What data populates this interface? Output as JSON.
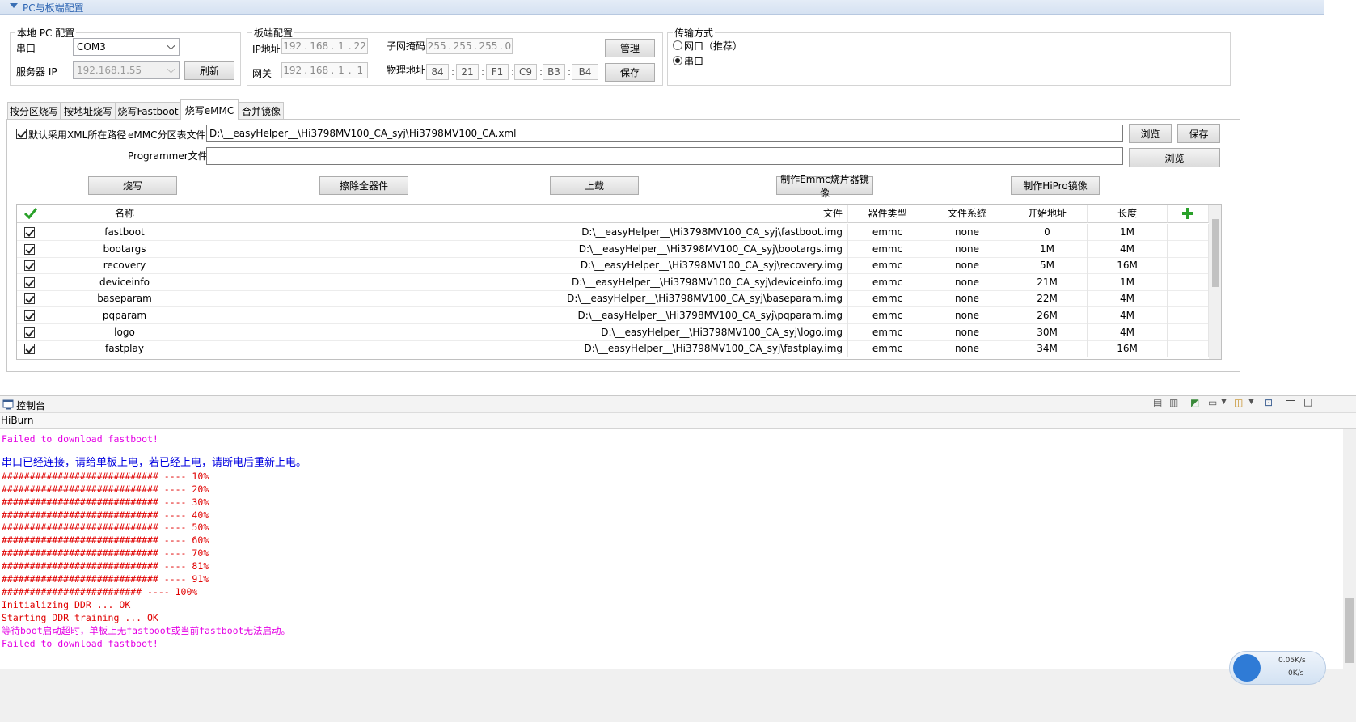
{
  "section_title": "PC与板端配置",
  "local_pc": {
    "group_title": "本地 PC 配置",
    "serial_label": "串口",
    "serial_value": "COM3",
    "server_ip_label": "服务器 IP",
    "server_ip_value": "192.168.1.55",
    "refresh_button": "刷新"
  },
  "board": {
    "group_title": "板端配置",
    "ip_label": "IP地址",
    "ip": [
      "192",
      "168",
      "1",
      "22"
    ],
    "gateway_label": "网关",
    "gateway": [
      "192",
      "168",
      "1",
      "1"
    ],
    "subnet_label": "子网掩码",
    "subnet": [
      "255",
      "255",
      "255",
      "0"
    ],
    "mac_label": "物理地址",
    "mac": [
      "84",
      "21",
      "F1",
      "C9",
      "B3",
      "B4"
    ],
    "manage_button": "管理",
    "save_button": "保存"
  },
  "transfer": {
    "group_title": "传输方式",
    "options": [
      "网口（推荐）",
      "串口"
    ],
    "selected": "串口"
  },
  "tabs": [
    "按分区烧写",
    "按地址烧写",
    "烧写Fastboot",
    "烧写eMMC",
    "合并镜像"
  ],
  "active_tab": "烧写eMMC",
  "emmc": {
    "use_xml_path_label": "默认采用XML所在路径",
    "use_xml_path_checked": true,
    "partition_file_label": "eMMC分区表文件",
    "partition_file_value": "D:\\__easyHelper__\\Hi3798MV100_CA_syj\\Hi3798MV100_CA.xml",
    "programmer_file_label": "Programmer文件",
    "programmer_file_value": "",
    "browse_label": "浏览",
    "save_label": "保存",
    "actions": [
      "烧写",
      "擦除全器件",
      "上载",
      "制作Emmc烧片器镜像",
      "制作HiPro镜像"
    ]
  },
  "table": {
    "columns": [
      "名称",
      "文件",
      "器件类型",
      "文件系统",
      "开始地址",
      "长度"
    ],
    "rows": [
      {
        "name": "fastboot",
        "file": "D:\\__easyHelper__\\Hi3798MV100_CA_syj\\fastboot.img",
        "device": "emmc",
        "fs": "none",
        "start": "0",
        "length": "1M"
      },
      {
        "name": "bootargs",
        "file": "D:\\__easyHelper__\\Hi3798MV100_CA_syj\\bootargs.img",
        "device": "emmc",
        "fs": "none",
        "start": "1M",
        "length": "4M"
      },
      {
        "name": "recovery",
        "file": "D:\\__easyHelper__\\Hi3798MV100_CA_syj\\recovery.img",
        "device": "emmc",
        "fs": "none",
        "start": "5M",
        "length": "16M"
      },
      {
        "name": "deviceinfo",
        "file": "D:\\__easyHelper__\\Hi3798MV100_CA_syj\\deviceinfo.img",
        "device": "emmc",
        "fs": "none",
        "start": "21M",
        "length": "1M"
      },
      {
        "name": "baseparam",
        "file": "D:\\__easyHelper__\\Hi3798MV100_CA_syj\\baseparam.img",
        "device": "emmc",
        "fs": "none",
        "start": "22M",
        "length": "4M"
      },
      {
        "name": "pqparam",
        "file": "D:\\__easyHelper__\\Hi3798MV100_CA_syj\\pqparam.img",
        "device": "emmc",
        "fs": "none",
        "start": "26M",
        "length": "4M"
      },
      {
        "name": "logo",
        "file": "D:\\__easyHelper__\\Hi3798MV100_CA_syj\\logo.img",
        "device": "emmc",
        "fs": "none",
        "start": "30M",
        "length": "4M"
      },
      {
        "name": "fastplay",
        "file": "D:\\__easyHelper__\\Hi3798MV100_CA_syj\\fastplay.img",
        "device": "emmc",
        "fs": "none",
        "start": "34M",
        "length": "16M"
      }
    ]
  },
  "console": {
    "tab_label": "控制台",
    "name": "HiBurn",
    "lines": [
      {
        "text": "Failed to download fastboot!",
        "color": "magenta"
      },
      {
        "text": "",
        "color": "blue"
      },
      {
        "text": "串口已经连接，请给单板上电，若已经上电，请断电后重新上电。",
        "color": "blue"
      },
      {
        "text": "############################ ---- 10%",
        "color": "red"
      },
      {
        "text": "############################ ---- 20%",
        "color": "red"
      },
      {
        "text": "############################ ---- 30%",
        "color": "red"
      },
      {
        "text": "############################ ---- 40%",
        "color": "red"
      },
      {
        "text": "############################ ---- 50%",
        "color": "red"
      },
      {
        "text": "############################ ---- 60%",
        "color": "red"
      },
      {
        "text": "############################ ---- 70%",
        "color": "red"
      },
      {
        "text": "############################ ---- 81%",
        "color": "red"
      },
      {
        "text": "############################ ---- 91%",
        "color": "red"
      },
      {
        "text": "######################### ---- 100%",
        "color": "red"
      },
      {
        "text": "Initializing DDR ... OK",
        "color": "red"
      },
      {
        "text": "Starting DDR training ... OK",
        "color": "red"
      },
      {
        "text": "等待boot启动超时，单板上无fastboot或当前fastboot无法启动。",
        "color": "magenta"
      },
      {
        "text": "Failed to download fastboot!",
        "color": "magenta"
      }
    ]
  },
  "net_widget": {
    "up": "0.05K/s",
    "down": "0K/s"
  },
  "colors": {
    "magenta": "#e400e4",
    "blue": "#0000e0",
    "red": "#e00000",
    "accent": "#2f66b3"
  }
}
